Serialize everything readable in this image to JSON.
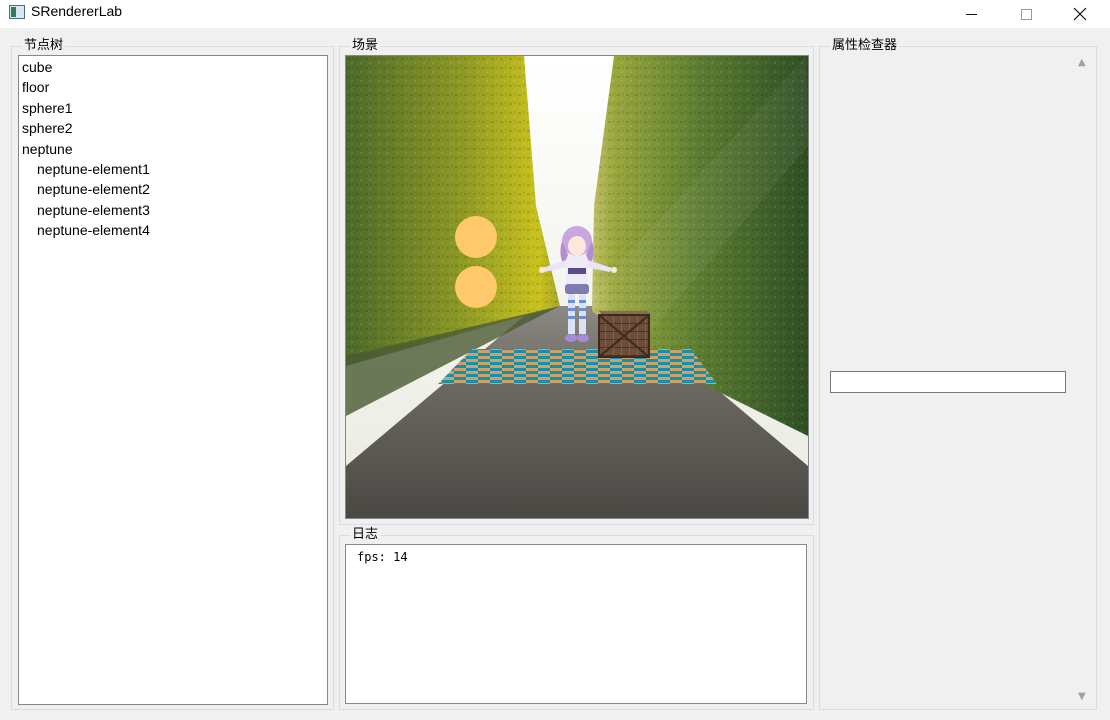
{
  "window": {
    "title": "SRendererLab",
    "minimize_glyph": "—",
    "maximize_glyph": "☐",
    "close_glyph": "✕"
  },
  "panels": {
    "node_tree": "节点树",
    "scene": "场景",
    "log": "日志",
    "inspector": "属性检查器"
  },
  "tree": {
    "items": [
      {
        "label": "cube",
        "depth": 0
      },
      {
        "label": "floor",
        "depth": 0
      },
      {
        "label": "sphere1",
        "depth": 0
      },
      {
        "label": "sphere2",
        "depth": 0
      },
      {
        "label": "neptune",
        "depth": 0
      },
      {
        "label": "neptune-element1",
        "depth": 1
      },
      {
        "label": "neptune-element2",
        "depth": 1
      },
      {
        "label": "neptune-element3",
        "depth": 1
      },
      {
        "label": "neptune-element4",
        "depth": 1
      }
    ]
  },
  "log": {
    "lines": [
      "fps: 14"
    ]
  },
  "inspector": {
    "input_value": ""
  },
  "colors": {
    "sphere": "#ffc86a",
    "floor_teal": "#1b8fa7",
    "floor_tan": "#c9a36b",
    "crate": "#6b4d38",
    "hedge_dark": "#35552a",
    "hedge_light": "#b4b21f",
    "sky": "#f3f3ec",
    "road": "#5e5a55"
  },
  "icons": {
    "app": "app-window-icon",
    "scroll_up": "scroll-up-arrow-icon",
    "scroll_down": "scroll-down-arrow-icon"
  }
}
